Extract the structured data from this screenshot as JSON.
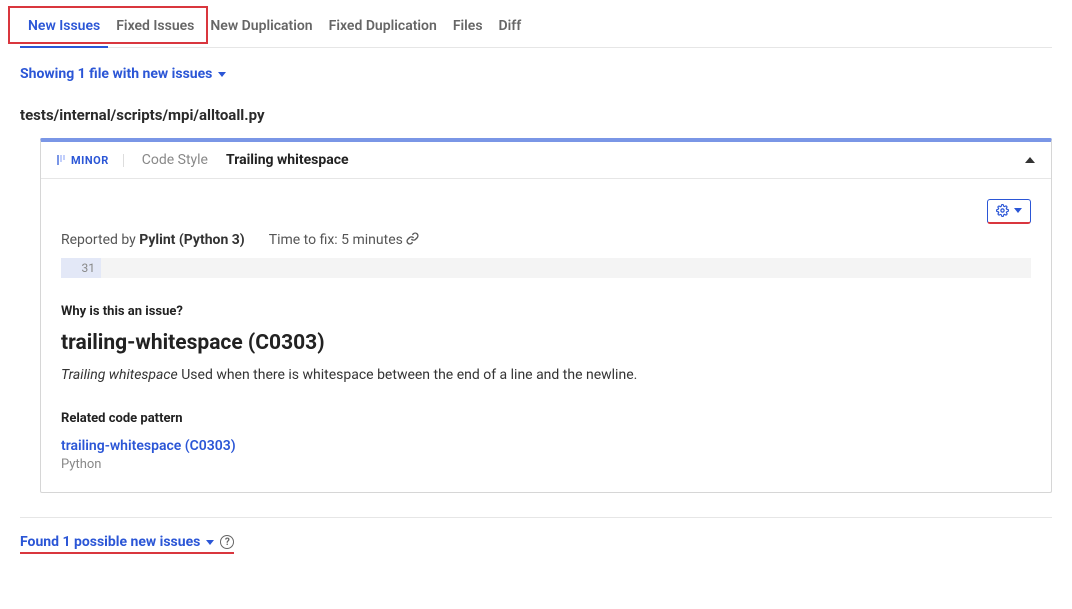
{
  "tabs": {
    "new_issues": "New Issues",
    "fixed_issues": "Fixed Issues",
    "new_duplication": "New Duplication",
    "fixed_duplication": "Fixed Duplication",
    "files": "Files",
    "diff": "Diff"
  },
  "filter_summary": "Showing 1 file with new issues",
  "file_path": "tests/internal/scripts/mpi/alltoall.py",
  "issue": {
    "severity": "MINOR",
    "category": "Code Style",
    "title": "Trailing whitespace",
    "reported_by_label": "Reported by ",
    "reported_by_tool": "Pylint (Python 3)",
    "time_to_fix_label": "Time to fix: ",
    "time_to_fix_value": "5 minutes",
    "line_number": "31",
    "why_heading": "Why is this an issue?",
    "rule_id": "trailing-whitespace (C0303)",
    "rule_desc_em": "Trailing whitespace",
    "rule_desc_rest": " Used when there is whitespace between the end of a line and the newline.",
    "pattern_heading": "Related code pattern",
    "pattern_link": "trailing-whitespace (C0303)",
    "pattern_lang": "Python"
  },
  "footer_summary": "Found 1 possible new issues",
  "help_glyph": "?"
}
